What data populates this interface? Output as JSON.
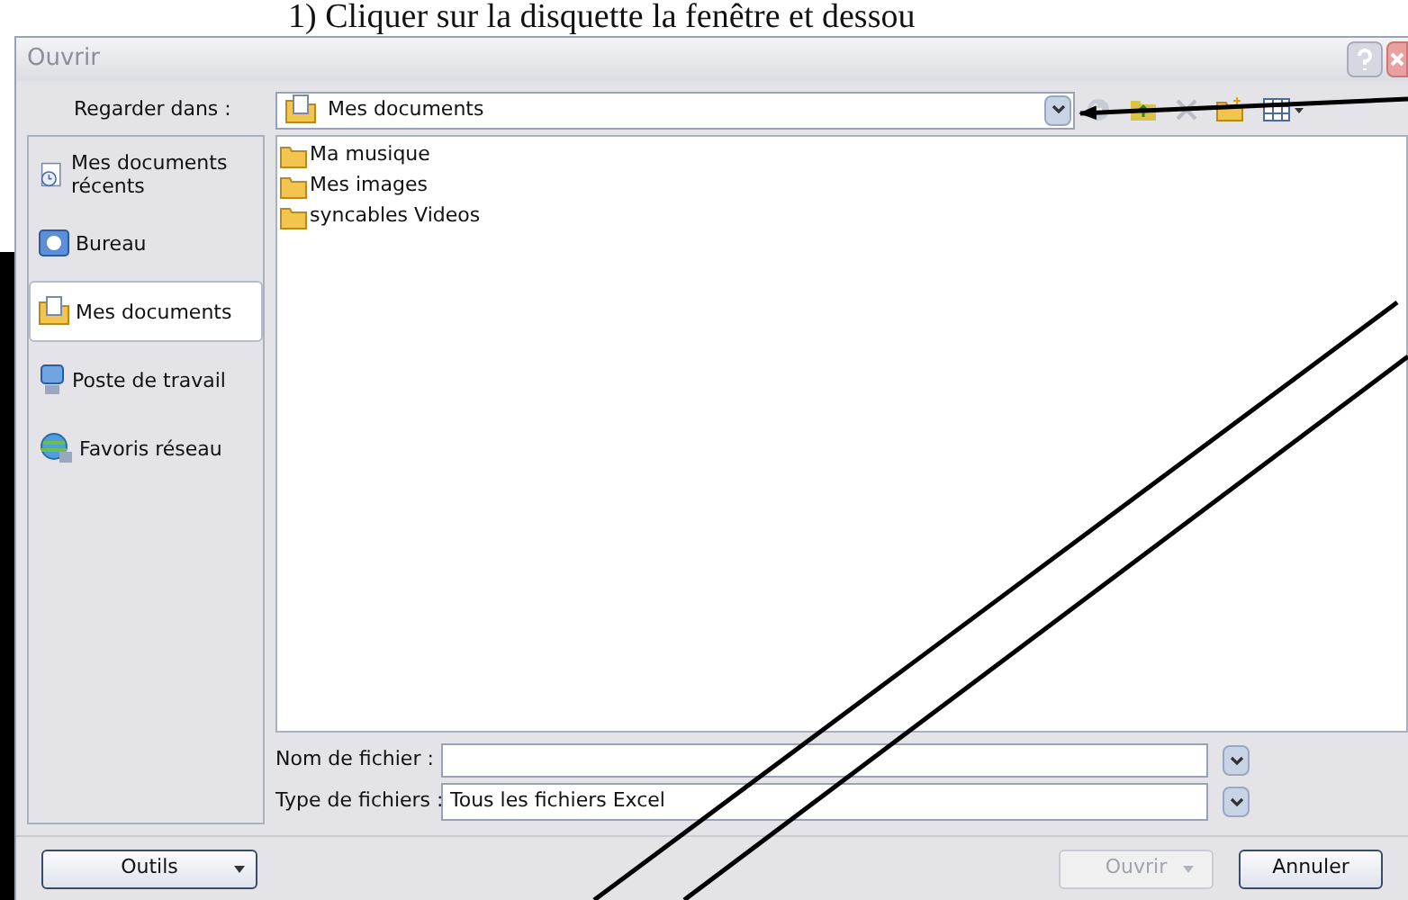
{
  "caption": "1) Cliquer sur la disquette la fenêtre et dessou",
  "window": {
    "title": "Ouvrir"
  },
  "look_in": {
    "label": "Regarder dans :",
    "value": "Mes documents"
  },
  "places": [
    {
      "label": "Mes documents récents",
      "selected": false,
      "kind": "recent"
    },
    {
      "label": "Bureau",
      "selected": false,
      "kind": "desktop"
    },
    {
      "label": "Mes documents",
      "selected": true,
      "kind": "documents"
    },
    {
      "label": "Poste de travail",
      "selected": false,
      "kind": "computer"
    },
    {
      "label": "Favoris réseau",
      "selected": false,
      "kind": "network"
    }
  ],
  "files": [
    {
      "name": "Ma musique"
    },
    {
      "name": "Mes images"
    },
    {
      "name": "syncables Videos"
    }
  ],
  "file_name": {
    "label": "Nom de fichier :"
  },
  "file_type": {
    "label": "Type de fichiers :",
    "value": "Tous les fichiers Excel"
  },
  "buttons": {
    "tools": {
      "label": "Outils"
    },
    "open": {
      "label": "Ouvrir",
      "disabled": true
    },
    "cancel": {
      "label": "Annuler",
      "disabled": false
    }
  }
}
